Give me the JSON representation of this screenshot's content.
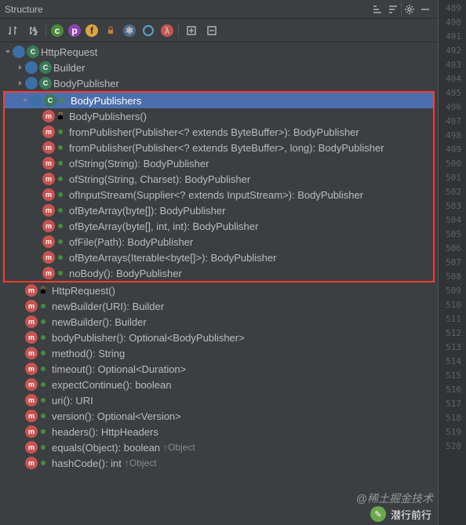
{
  "header": {
    "title": "Structure"
  },
  "gutter_start": 489,
  "gutter_count": 32,
  "root": {
    "name": "HttpRequest",
    "children_top": [
      {
        "name": "Builder"
      },
      {
        "name": "BodyPublisher"
      }
    ],
    "body_publishers": {
      "name": "BodyPublishers",
      "items": [
        {
          "sig": "BodyPublishers()",
          "mod": "lock"
        },
        {
          "sig": "fromPublisher(Publisher<? extends ByteBuffer>): BodyPublisher",
          "mod": "dot"
        },
        {
          "sig": "fromPublisher(Publisher<? extends ByteBuffer>, long): BodyPublisher",
          "mod": "dot"
        },
        {
          "sig": "ofString(String): BodyPublisher",
          "mod": "dot"
        },
        {
          "sig": "ofString(String, Charset): BodyPublisher",
          "mod": "dot"
        },
        {
          "sig": "ofInputStream(Supplier<? extends InputStream>): BodyPublisher",
          "mod": "dot"
        },
        {
          "sig": "ofByteArray(byte[]): BodyPublisher",
          "mod": "dot"
        },
        {
          "sig": "ofByteArray(byte[], int, int): BodyPublisher",
          "mod": "dot"
        },
        {
          "sig": "ofFile(Path): BodyPublisher",
          "mod": "dot"
        },
        {
          "sig": "ofByteArrays(Iterable<byte[]>): BodyPublisher",
          "mod": "dot"
        },
        {
          "sig": "noBody(): BodyPublisher",
          "mod": "dot"
        }
      ]
    },
    "methods": [
      {
        "sig": "HttpRequest()",
        "mod": "lock"
      },
      {
        "sig": "newBuilder(URI): Builder",
        "mod": "dot"
      },
      {
        "sig": "newBuilder(): Builder",
        "mod": "dot"
      },
      {
        "sig": "bodyPublisher(): Optional<BodyPublisher>",
        "mod": "dot"
      },
      {
        "sig": "method(): String",
        "mod": "dot"
      },
      {
        "sig": "timeout(): Optional<Duration>",
        "mod": "dot"
      },
      {
        "sig": "expectContinue(): boolean",
        "mod": "dot"
      },
      {
        "sig": "uri(): URI",
        "mod": "dot"
      },
      {
        "sig": "version(): Optional<Version>",
        "mod": "dot"
      },
      {
        "sig": "headers(): HttpHeaders",
        "mod": "dot"
      },
      {
        "sig": "equals(Object): boolean",
        "mod": "dot",
        "up": "↑Object"
      },
      {
        "sig": "hashCode(): int",
        "mod": "dot",
        "up": "↑Object"
      }
    ]
  },
  "watermark": "@稀土掘金技术",
  "footer": {
    "name": "潜行前行"
  }
}
